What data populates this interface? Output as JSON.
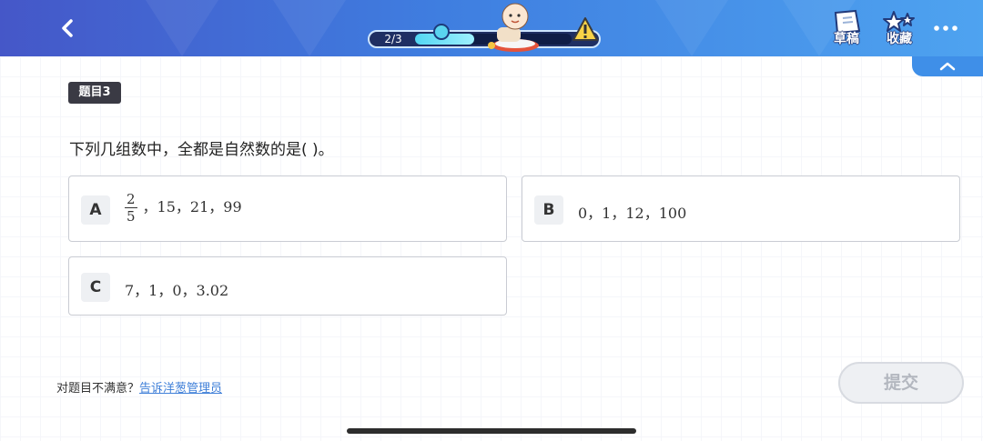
{
  "header": {
    "progress": {
      "label": "2/3",
      "current": 2,
      "total": 3,
      "fraction": 0.38
    },
    "draft_label": "草稿",
    "favorite_label": "收藏",
    "icons": [
      "chevron-left-icon",
      "warning-icon",
      "draft-paper-icon",
      "star-icon",
      "more-dots-icon",
      "chevron-up-icon"
    ]
  },
  "question": {
    "tag": "题目3",
    "text": "下列几组数中，全都是自然数的是(   )。",
    "options": [
      {
        "letter": "A",
        "fraction": {
          "numerator": "2",
          "denominator": "5"
        },
        "text": "，15，21，99"
      },
      {
        "letter": "B",
        "text": "0，1，12，100"
      },
      {
        "letter": "C",
        "text": "7，1，0，3.02"
      }
    ]
  },
  "footer": {
    "feedback_prefix": "对题目不满意？",
    "feedback_link": "告诉洋葱管理员",
    "submit_label": "提交"
  },
  "colors": {
    "header_start": "#4557c8",
    "header_end": "#4ea3f0",
    "link": "#3f7fd8",
    "submit_disabled_text": "#b3b7bf"
  }
}
